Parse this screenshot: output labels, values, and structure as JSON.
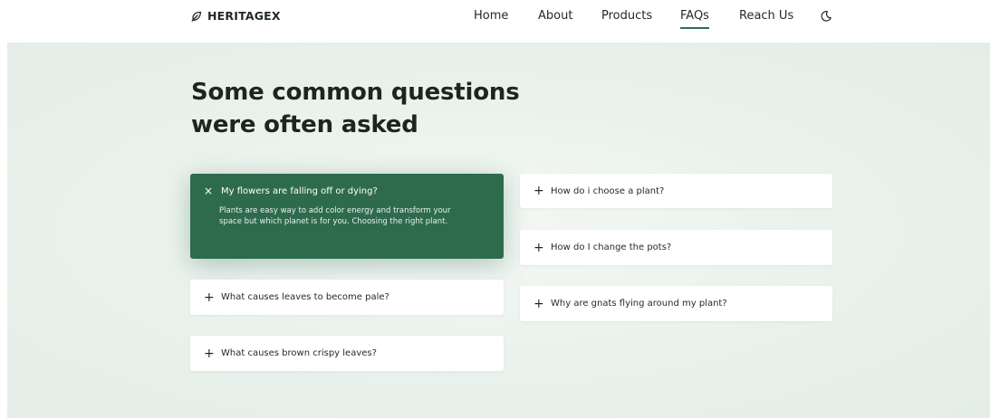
{
  "brand": {
    "name": "HERITAGEX",
    "icon": "leaf-icon"
  },
  "nav": {
    "links": [
      {
        "label": "Home",
        "active": false
      },
      {
        "label": "About",
        "active": false
      },
      {
        "label": "Products",
        "active": false
      },
      {
        "label": "FAQs",
        "active": true
      },
      {
        "label": "Reach Us",
        "active": false
      }
    ],
    "theme_toggle_icon": "moon-icon"
  },
  "faq_section": {
    "heading": "Some common questions were often asked",
    "left_column": [
      {
        "question": "My flowers are falling off or dying?",
        "answer": "Plants are easy way to add color energy and transform your space but which planet is for you. Choosing the right plant.",
        "open": true,
        "sign": "×"
      },
      {
        "question": "What causes leaves to become pale?",
        "open": false,
        "sign": "+"
      },
      {
        "question": "What causes brown crispy leaves?",
        "open": false,
        "sign": "+"
      }
    ],
    "right_column": [
      {
        "question": "How do i choose a plant?",
        "open": false,
        "sign": "+"
      },
      {
        "question": "How do I change the pots?",
        "open": false,
        "sign": "+"
      },
      {
        "question": "Why are gnats flying around my plant?",
        "open": false,
        "sign": "+"
      }
    ]
  },
  "colors": {
    "accent": "#2e6b4c",
    "section_background": "#e9f1ec",
    "text": "#1f2a24"
  }
}
